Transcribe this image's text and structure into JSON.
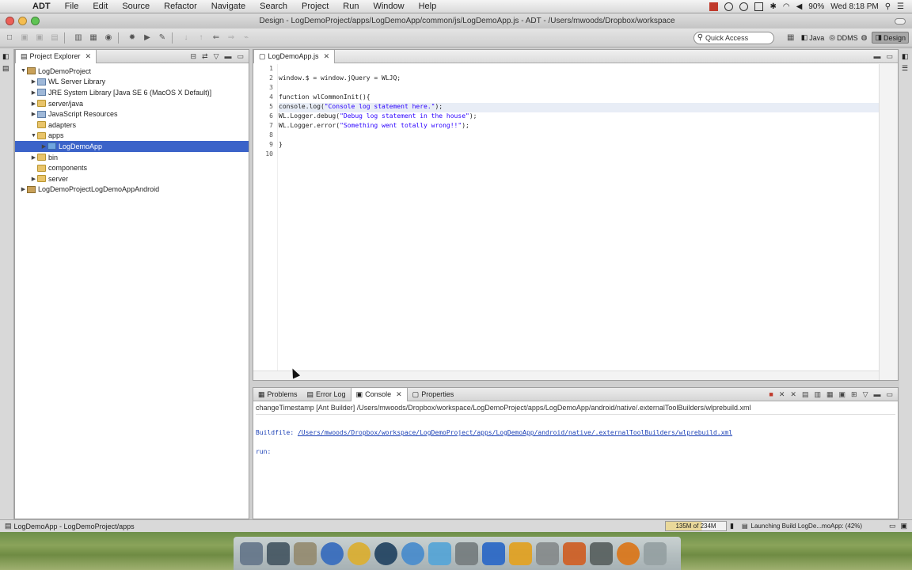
{
  "menubar": {
    "app_name": "ADT",
    "menus": [
      "File",
      "Edit",
      "Source",
      "Refactor",
      "Navigate",
      "Search",
      "Project",
      "Run",
      "Window",
      "Help"
    ],
    "battery": "90%",
    "clock": "Wed 8:18 PM"
  },
  "window": {
    "title": "Design - LogDemoProject/apps/LogDemoApp/common/js/LogDemoApp.js - ADT - /Users/mwoods/Dropbox/workspace"
  },
  "toolbar": {
    "quick_access_placeholder": "Quick Access",
    "perspectives": [
      "Java",
      "DDMS",
      "Design"
    ],
    "active_perspective": "Design"
  },
  "explorer": {
    "tab_label": "Project Explorer",
    "tree": [
      {
        "label": "LogDemoProject",
        "depth": 0,
        "twisty": "▼",
        "icon": "proj"
      },
      {
        "label": "WL Server Library",
        "depth": 1,
        "twisty": "▶",
        "icon": "lib"
      },
      {
        "label": "JRE System Library [Java SE 6 (MacOS X Default)]",
        "depth": 1,
        "twisty": "▶",
        "icon": "lib"
      },
      {
        "label": "server/java",
        "depth": 1,
        "twisty": "▶",
        "icon": "folder"
      },
      {
        "label": "JavaScript Resources",
        "depth": 1,
        "twisty": "▶",
        "icon": "lib"
      },
      {
        "label": "adapters",
        "depth": 1,
        "twisty": "",
        "icon": "folder"
      },
      {
        "label": "apps",
        "depth": 1,
        "twisty": "▼",
        "icon": "folder"
      },
      {
        "label": "LogDemoApp",
        "depth": 2,
        "twisty": "▶",
        "icon": "app",
        "selected": true
      },
      {
        "label": "bin",
        "depth": 1,
        "twisty": "▶",
        "icon": "folder"
      },
      {
        "label": "components",
        "depth": 1,
        "twisty": "",
        "icon": "folder"
      },
      {
        "label": "server",
        "depth": 1,
        "twisty": "▶",
        "icon": "folder"
      },
      {
        "label": "LogDemoProjectLogDemoAppAndroid",
        "depth": 0,
        "twisty": "▶",
        "icon": "proj"
      }
    ]
  },
  "editor": {
    "tab_label": "LogDemoApp.js",
    "line_numbers": [
      "1",
      "2",
      "3",
      "4",
      "5",
      "6",
      "7",
      "8",
      "9",
      "10"
    ],
    "code": {
      "l2": "window.$ = window.jQuery = WLJQ;",
      "l4": "function wlCommonInit(){",
      "l5_obj": "console.log(",
      "l5_str": "\"Console log statement here.\"",
      "l5_end": ");",
      "l6_obj": "WL.Logger.debug(",
      "l6_str": "\"Debug log statement in the house\"",
      "l6_end": ");",
      "l7_obj": "WL.Logger.error(",
      "l7_str": "\"Something went totally wrong!!\"",
      "l7_end": ");",
      "l9": "}"
    }
  },
  "console": {
    "tabs": [
      "Problems",
      "Error Log",
      "Console",
      "Properties"
    ],
    "active_tab": "Console",
    "header": "changeTimestamp [Ant Builder] /Users/mwoods/Dropbox/workspace/LogDemoProject/apps/LogDemoApp/android/native/.externalToolBuilders/wlprebuild.xml",
    "buildfile_label": "Buildfile: ",
    "buildfile_path": "/Users/mwoods/Dropbox/workspace/LogDemoProject/apps/LogDemoApp/android/native/.externalToolBuilders/wlprebuild.xml",
    "run_line": "run:"
  },
  "statusbar": {
    "selection": "LogDemoApp - LogDemoProject/apps",
    "heap": "135M of 234M",
    "heap_used_fraction": 0.58,
    "progress": "Launching Build LogDe...moApp: (42%)",
    "progress_percent": 42
  },
  "icons": {
    "search": "magnifier-icon",
    "close": "close-icon"
  }
}
